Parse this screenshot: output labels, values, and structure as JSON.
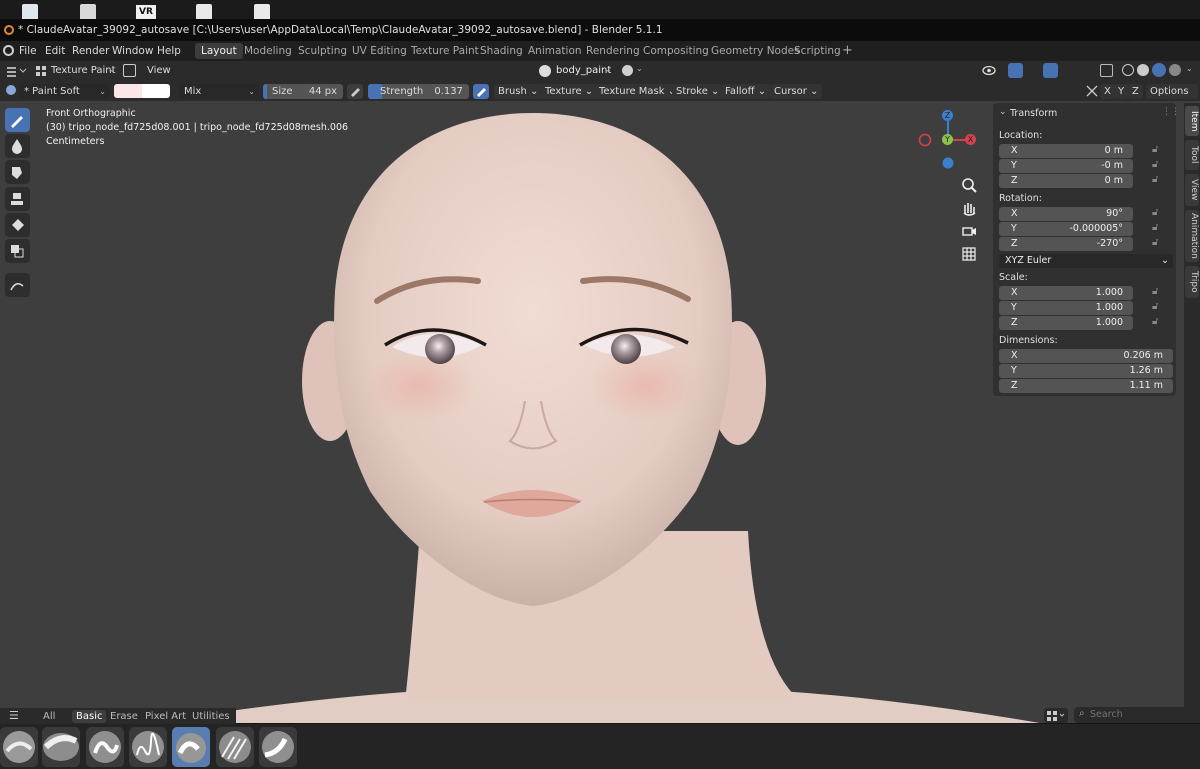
{
  "window": {
    "title": "* ClaudeAvatar_39092_autosave [C:\\Users\\user\\AppData\\Local\\Temp\\ClaudeAvatar_39092_autosave.blend] - Blender 5.1.1"
  },
  "desktop": {
    "vr_label": "VR"
  },
  "menu": {
    "file": "File",
    "edit": "Edit",
    "render": "Render",
    "window": "Window",
    "help": "Help"
  },
  "workspaces": {
    "layout": "Layout",
    "modeling": "Modeling",
    "sculpting": "Sculpting",
    "uv_editing": "UV Editing",
    "texture_paint": "Texture Paint",
    "shading": "Shading",
    "animation": "Animation",
    "rendering": "Rendering",
    "compositing": "Compositing",
    "geometry_nodes": "Geometry Nodes",
    "scripting": "Scripting",
    "add": "+"
  },
  "header": {
    "mode": "Texture Paint",
    "view": "View",
    "material": "body_paint"
  },
  "toolsettings": {
    "brush_name": "* Paint Soft",
    "blend": "Mix",
    "size_label": "Size",
    "size_value": "44 px",
    "strength_label": "Strength",
    "strength_value": "0.137",
    "strength_fraction": 0.137,
    "brush_menu": "Brush",
    "texture_menu": "Texture",
    "texture_mask_menu": "Texture Mask",
    "stroke_menu": "Stroke",
    "falloff_menu": "Falloff",
    "cursor_menu": "Cursor",
    "x": "X",
    "y": "Y",
    "z": "Z",
    "options": "Options",
    "primary_color": "#fbe7e7",
    "secondary_color": "#ffffff"
  },
  "viewport": {
    "view_name": "Front Orthographic",
    "object_info": "(30) tripo_node_fd725d08.001 | tripo_node_fd725d08mesh.006",
    "units": "Centimeters",
    "gizmo": {
      "x": "X",
      "y": "Y",
      "z": "Z"
    }
  },
  "npanel": {
    "section": "Transform",
    "location_label": "Location:",
    "location": [
      {
        "axis": "X",
        "value": "0 m"
      },
      {
        "axis": "Y",
        "value": "-0 m"
      },
      {
        "axis": "Z",
        "value": "0 m"
      }
    ],
    "rotation_label": "Rotation:",
    "rotation": [
      {
        "axis": "X",
        "value": "90°"
      },
      {
        "axis": "Y",
        "value": "-0.000005°"
      },
      {
        "axis": "Z",
        "value": "-270°"
      }
    ],
    "rotation_mode": "XYZ Euler",
    "scale_label": "Scale:",
    "scale": [
      {
        "axis": "X",
        "value": "1.000"
      },
      {
        "axis": "Y",
        "value": "1.000"
      },
      {
        "axis": "Z",
        "value": "1.000"
      }
    ],
    "dimensions_label": "Dimensions:",
    "dimensions": [
      {
        "axis": "X",
        "value": "0.206 m"
      },
      {
        "axis": "Y",
        "value": "1.26 m"
      },
      {
        "axis": "Z",
        "value": "1.11 m"
      }
    ]
  },
  "sidetabs": {
    "item": "Item",
    "tool": "Tool",
    "view": "View",
    "animation": "Animation",
    "tripo": "Tripo"
  },
  "shelf": {
    "all": "All",
    "basic": "Basic",
    "erase": "Erase",
    "pixel_art": "Pixel Art",
    "utilities": "Utilities",
    "search_placeholder": "Search"
  },
  "colors": {
    "accent": "#4772b3",
    "axis_x": "#d6404e",
    "axis_y": "#8bc34a",
    "axis_z": "#3c7fcf"
  }
}
